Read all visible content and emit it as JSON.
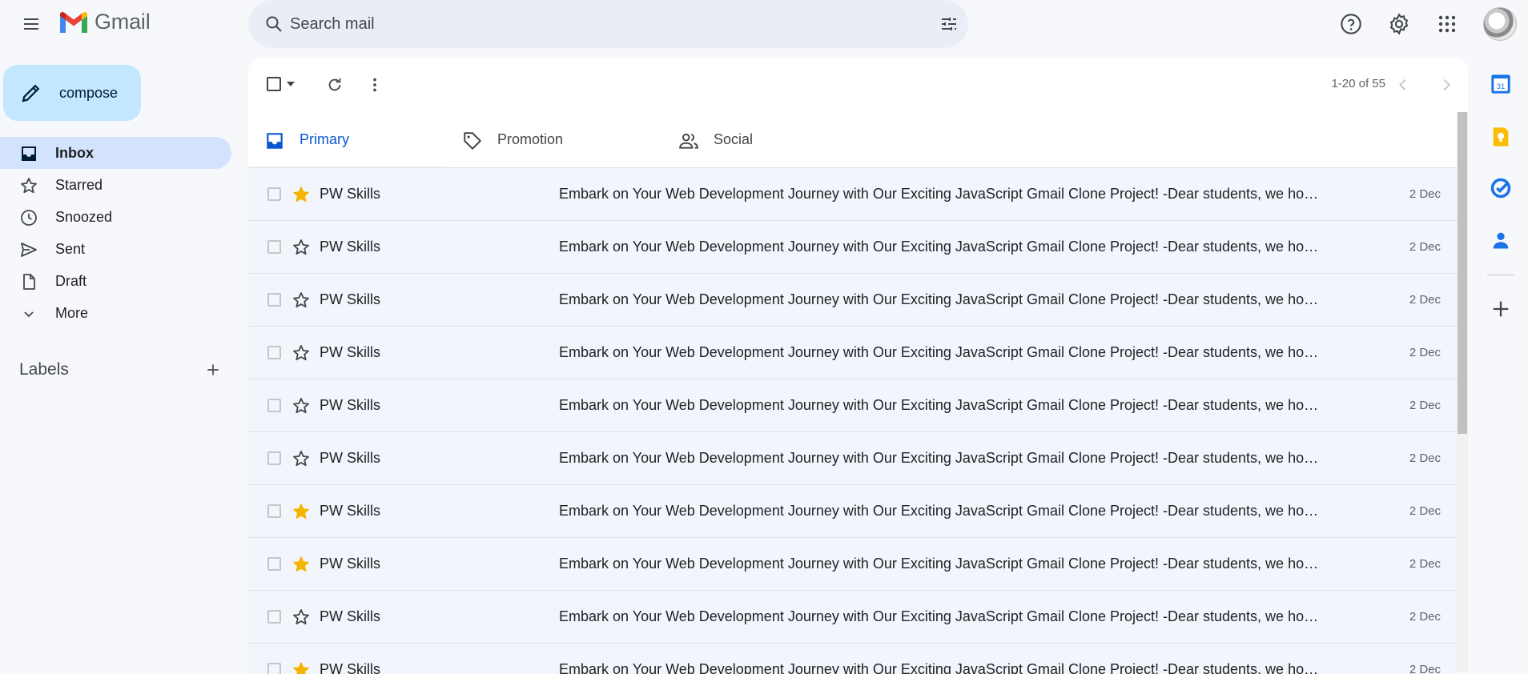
{
  "app": {
    "brand": "Gmail",
    "menu_icon": "hamburger-menu-icon"
  },
  "search": {
    "placeholder": "Search mail",
    "icon": "search-icon",
    "options_icon": "tune-icon"
  },
  "header_icons": [
    "help-icon",
    "settings-gear-icon",
    "apps-grid-icon",
    "account-avatar"
  ],
  "compose": {
    "label": "compose",
    "icon": "pencil-icon"
  },
  "sidebar": {
    "items": [
      {
        "label": "Inbox",
        "icon": "inbox-icon",
        "active": true
      },
      {
        "label": "Starred",
        "icon": "star-icon",
        "active": false
      },
      {
        "label": "Snoozed",
        "icon": "clock-icon",
        "active": false
      },
      {
        "label": "Sent",
        "icon": "send-icon",
        "active": false
      },
      {
        "label": "Draft",
        "icon": "draft-icon",
        "active": false
      },
      {
        "label": "More",
        "icon": "chevron-down-icon",
        "active": false
      }
    ],
    "labels_title": "Labels",
    "labels_add_icon": "plus-icon"
  },
  "toolbar": {
    "pagination": "1-20 of 55",
    "icons": [
      "select-all-checkbox",
      "caret-down-icon",
      "refresh-icon",
      "more-vert-icon",
      "chevron-left-icon",
      "chevron-right-icon"
    ]
  },
  "tabs": [
    {
      "label": "Primary",
      "icon": "inbox-icon",
      "active": true
    },
    {
      "label": "Promotion",
      "icon": "tag-icon",
      "active": false
    },
    {
      "label": "Social",
      "icon": "people-icon",
      "active": false
    }
  ],
  "emails": [
    {
      "sender": "PW Skills",
      "subject": "Embark on Your Web Development Journey with Our Exciting JavaScript Gmail Clone Project! -Dear students, we hope thi...",
      "date": "2 Dec",
      "starred": true
    },
    {
      "sender": "PW Skills",
      "subject": "Embark on Your Web Development Journey with Our Exciting JavaScript Gmail Clone Project! -Dear students, we hope thi...",
      "date": "2 Dec",
      "starred": false
    },
    {
      "sender": "PW Skills",
      "subject": "Embark on Your Web Development Journey with Our Exciting JavaScript Gmail Clone Project! -Dear students, we hope thi...",
      "date": "2 Dec",
      "starred": false
    },
    {
      "sender": "PW Skills",
      "subject": "Embark on Your Web Development Journey with Our Exciting JavaScript Gmail Clone Project! -Dear students, we hope thi...",
      "date": "2 Dec",
      "starred": false
    },
    {
      "sender": "PW Skills",
      "subject": "Embark on Your Web Development Journey with Our Exciting JavaScript Gmail Clone Project! -Dear students, we hope thi...",
      "date": "2 Dec",
      "starred": false
    },
    {
      "sender": "PW Skills",
      "subject": "Embark on Your Web Development Journey with Our Exciting JavaScript Gmail Clone Project! -Dear students, we hope thi...",
      "date": "2 Dec",
      "starred": false
    },
    {
      "sender": "PW Skills",
      "subject": "Embark on Your Web Development Journey with Our Exciting JavaScript Gmail Clone Project! -Dear students, we hope thi...",
      "date": "2 Dec",
      "starred": true
    },
    {
      "sender": "PW Skills",
      "subject": "Embark on Your Web Development Journey with Our Exciting JavaScript Gmail Clone Project! -Dear students, we hope thi...",
      "date": "2 Dec",
      "starred": true
    },
    {
      "sender": "PW Skills",
      "subject": "Embark on Your Web Development Journey with Our Exciting JavaScript Gmail Clone Project! -Dear students, we hope thi...",
      "date": "2 Dec",
      "starred": false
    },
    {
      "sender": "PW Skills",
      "subject": "Embark on Your Web Development Journey with Our Exciting JavaScript Gmail Clone Project! -Dear students, we hope thi...",
      "date": "2 Dec",
      "starred": true
    }
  ],
  "right_rail": [
    "calendar-icon",
    "keep-icon",
    "tasks-icon",
    "contacts-icon",
    "add-addon-icon"
  ],
  "colors": {
    "background": "#f6f8fc",
    "compose": "#c2e7ff",
    "active_nav": "#d3e3fd",
    "primary_tab": "#0b57d0",
    "star": "#f4b400",
    "row_read": "#f2f6fc"
  }
}
